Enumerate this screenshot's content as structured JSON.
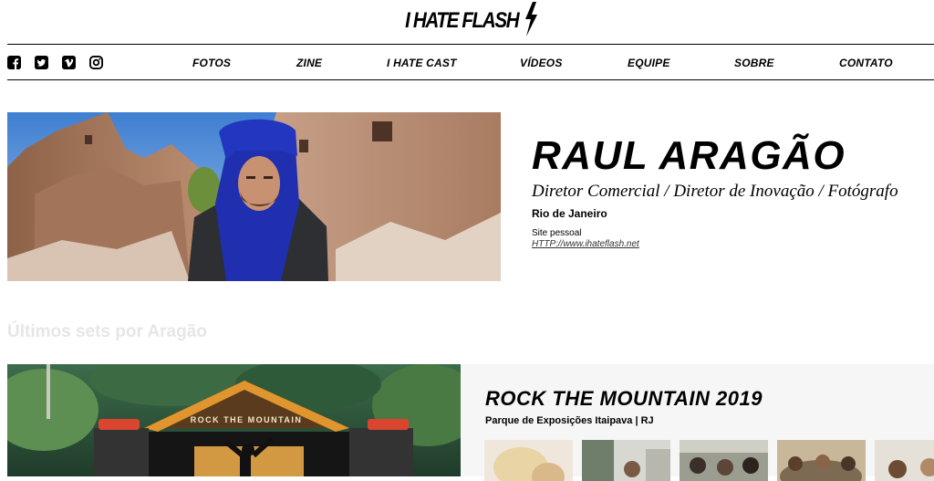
{
  "logo": {
    "text": "I HATE FLASH",
    "icon": "lightning-bolt-icon"
  },
  "social": [
    {
      "name": "facebook-icon",
      "color": "#000000"
    },
    {
      "name": "twitter-icon",
      "color": "#000000"
    },
    {
      "name": "vimeo-icon",
      "color": "#000000"
    },
    {
      "name": "instagram-icon",
      "color": "#000000"
    }
  ],
  "nav": [
    "FOTOS",
    "ZINE",
    "I HATE CAST",
    "VÍDEOS",
    "EQUIPE",
    "SOBRE",
    "CONTATO"
  ],
  "profile": {
    "name": "RAUL ARAGÃO",
    "roles": "Diretor Comercial / Diretor de Inovação / Fotógrafo",
    "city": "Rio de Janeiro",
    "site_label": "Site pessoal",
    "site_url": "HTTP://www.ihateflash.net"
  },
  "sets": {
    "section_title": "Últimos sets por Aragão",
    "items": [
      {
        "title": "ROCK THE MOUNTAIN 2019",
        "location": "Parque de Exposições Itaipava | RJ",
        "stage_sign": "ROCK THE MOUNTAIN"
      }
    ]
  },
  "colors": {
    "accent": "#000000",
    "section_title": "#e6e6e6",
    "panel_bg": "#f6f6f6",
    "turban": "#1f2fb0"
  }
}
